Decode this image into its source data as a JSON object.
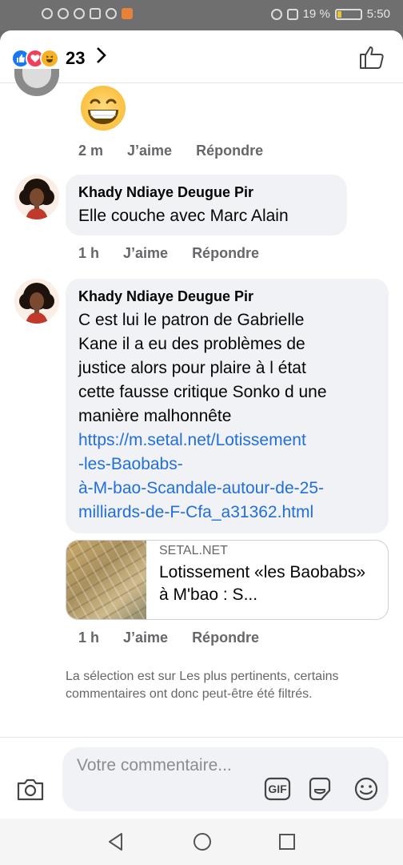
{
  "status": {
    "battery_percent": "19 %",
    "time": "5:50"
  },
  "header": {
    "reaction_count": "23"
  },
  "comments": [
    {
      "time": "2 m",
      "like_label": "J’aime",
      "reply_label": "Répondre"
    },
    {
      "author": "Khady Ndiaye Deugue Pir",
      "text": "Elle couche avec Marc Alain",
      "time": "1 h",
      "like_label": "J’aime",
      "reply_label": "Répondre"
    },
    {
      "author": "Khady Ndiaye Deugue Pir",
      "text_lines": [
        "C est lui le patron de Gabrielle",
        "Kane il a eu des problèmes de",
        "justice alors pour plaire à l état",
        "cette fausse critique Sonko d une",
        "manière malhonnête"
      ],
      "link_lines": [
        "https://m.setal.net/Lotissement",
        "-les-Baobabs-",
        "à-M-bao-Scandale-autour-de-25-",
        "milliards-de-F-Cfa_a31362.html"
      ],
      "preview": {
        "domain": "SETAL.NET",
        "title": "Lotissement «les Baobabs» à M'bao : S..."
      },
      "time": "1 h",
      "like_label": "J’aime",
      "reply_label": "Répondre"
    }
  ],
  "filter_note": "La sélection est sur Les plus pertinents, certains commentaires ont donc peut-être été filtrés.",
  "composer": {
    "placeholder": "Votre commentaire...",
    "gif_label": "GIF"
  }
}
